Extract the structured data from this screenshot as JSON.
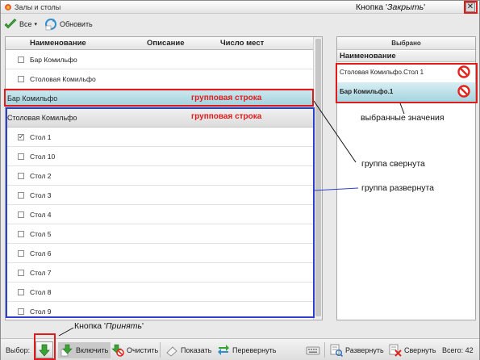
{
  "window": {
    "title": "Залы и столы"
  },
  "annotations": {
    "close_prefix": "Кнопка '",
    "close_name": "Закрыть",
    "close_suffix": "'",
    "group_row_1": "групповая строка",
    "group_row_2": "групповая строка",
    "selected_values": "выбранные значения",
    "group_collapsed": "группа свернута",
    "group_expanded": "группа развернута",
    "accept_prefix": "Кнопка '",
    "accept_name": "Принять",
    "accept_suffix": "'"
  },
  "toolbar": {
    "all_label": "Все",
    "refresh_label": "Обновить"
  },
  "grid": {
    "columns": [
      "Наименование",
      "Описание",
      "Число мест"
    ],
    "rows_top": [
      "Бар Комильфо",
      "Столовая Комильфо"
    ],
    "group_1": "Бар Комильфо",
    "group_2": "Столовая Комильфо",
    "group_2_rows": [
      {
        "label": "Стол 1",
        "checked": true
      },
      {
        "label": "Стол 10",
        "checked": false
      },
      {
        "label": "Стол 2",
        "checked": false
      },
      {
        "label": "Стол 3",
        "checked": false
      },
      {
        "label": "Стол 4",
        "checked": false
      },
      {
        "label": "Стол 5",
        "checked": false
      },
      {
        "label": "Стол 6",
        "checked": false
      },
      {
        "label": "Стол 7",
        "checked": false
      },
      {
        "label": "Стол 8",
        "checked": false
      },
      {
        "label": "Стол 9",
        "checked": false
      }
    ]
  },
  "selected": {
    "title": "Выбрано",
    "column": "Наименование",
    "items": [
      "Столовая Комильфо.Стол 1",
      "Бар Комильфо.1"
    ]
  },
  "bottom": {
    "selection_label": "Выбор:",
    "include_label": "Включить",
    "clear_label": "Очистить",
    "show_label": "Показать",
    "invert_label": "Перевернуть",
    "expand_label": "Развернуть",
    "collapse_label": "Свернуть",
    "total_label": "Всего: 42"
  },
  "colors": {
    "annotation_red": "#e01b1b",
    "annotation_blue": "#2d3fcf",
    "group_highlight": "#a5d4df"
  }
}
